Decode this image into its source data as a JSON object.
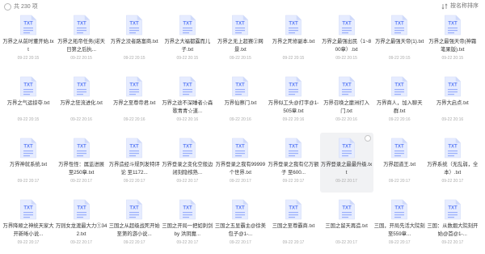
{
  "toolbar": {
    "count_label": "共 230 项",
    "sort_label": "按名称排序",
    "sort_icon": "sort-icon"
  },
  "file_icon": {
    "type_label": "TXT",
    "color": "#5b7cf5",
    "bg": "#e6ecff"
  },
  "files": [
    {
      "name": "万界之从前时董开始.txt",
      "date": "09-22 20:15"
    },
    {
      "name": "万界之拓帝任务(诺天日第之后执...",
      "date": "09-22 20:15"
    },
    {
      "name": "万界之没者路富商.txt",
      "date": "09-22 20:15"
    },
    {
      "name": "万界之大福都露而儿子.txt",
      "date": "09-22 20:15"
    },
    {
      "name": "万界之无上超赛②网景.txt",
      "date": "09-22 20:15"
    },
    {
      "name": "万界之死修副本.txt",
      "date": "09-22 20:15"
    },
    {
      "name": "万界之最强出民（1~800章）.txt",
      "date": "09-22 20:15"
    },
    {
      "name": "万界之最强天帝(1).txt",
      "date": "09-22 20:15"
    },
    {
      "name": "万界之最强天帝(神霜笔果版).txt",
      "date": "09-22 20:15"
    },
    {
      "name": "万界之气运掠夺.txt",
      "date": "09-22 20:15"
    },
    {
      "name": "万界之狂流进化.txt",
      "date": "09-22 20:16"
    },
    {
      "name": "万界之至尊帝君.txt",
      "date": "09-22 20:16"
    },
    {
      "name": "万界之途不深睡者☆森歌青青☆道...",
      "date": "09-22 20:16"
    },
    {
      "name": "万界仙察门.txt",
      "date": "09-22 20:16"
    },
    {
      "name": "万界似工头@打字@1-505章.txt",
      "date": "09-22 20:16"
    },
    {
      "name": "万界召唤之靡洲打入门.txt",
      "date": "09-22 20:16"
    },
    {
      "name": "万界商人，加入聊天群.txt",
      "date": "09-22 20:16"
    },
    {
      "name": "万界大启点.txt",
      "date": "09-22 20:16"
    },
    {
      "name": "万界神就系统.txt",
      "date": "09-22 20:17"
    },
    {
      "name": "万界性怪：属监进展 至250章.txt",
      "date": "09-22 20:17"
    },
    {
      "name": "万界造经斗规列发特评论 至1172...",
      "date": "09-22 20:17"
    },
    {
      "name": "万界登录之变化空般边闭刻隐核熟...",
      "date": "09-22 20:17"
    },
    {
      "name": "万界登录之我有99999个世界.txt",
      "date": "09-22 20:17"
    },
    {
      "name": "万界登录之我有亿万额子 至600...",
      "date": "09-22 20:17"
    },
    {
      "name": "万界登录之最最升级.txt",
      "date": "09-22 20:17"
    },
    {
      "name": "万界超道王.txt",
      "date": "09-22 20:17"
    },
    {
      "name": "万界系统（无乱弱，全本）.txt",
      "date": "09-22 20:17"
    },
    {
      "name": "万界降顺之神统天家大开新晰小说...",
      "date": "09-22 20:17"
    },
    {
      "name": "万则女龙渡最大力①342.txt",
      "date": "09-22 20:17"
    },
    {
      "name": "三国之从超级战死开始至第的游小说...",
      "date": "09-22 20:17"
    },
    {
      "name": "三国之开局一把如刺剑 by 洪阴魔...",
      "date": "09-22 20:17"
    },
    {
      "name": "三国之五显霸主@徐美包子@1-...",
      "date": "09-22 20:17"
    },
    {
      "name": "三国之至尊霸商.txt",
      "date": "09-22 20:17"
    },
    {
      "name": "三国之留天再造.txt",
      "date": "09-22 20:17"
    },
    {
      "name": "三国，开局先活大院刻 至559章...",
      "date": "09-22 20:17"
    },
    {
      "name": "三国：从数烟大院刻开始@首@1-...",
      "date": "09-22 20:17"
    }
  ]
}
